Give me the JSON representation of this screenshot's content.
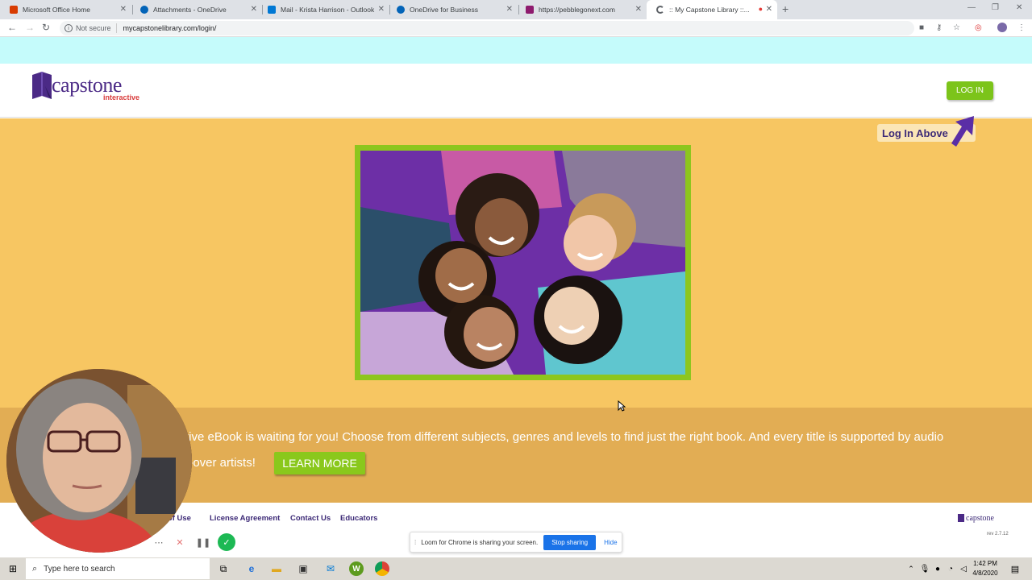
{
  "tabs": [
    {
      "title": "Microsoft Office Home",
      "color": "#d83b01"
    },
    {
      "title": "Attachments - OneDrive",
      "color": "#0364b8"
    },
    {
      "title": "Mail - Krista Harrison - Outlook",
      "color": "#0078d4"
    },
    {
      "title": "OneDrive for Business",
      "color": "#0364b8"
    },
    {
      "title": "https://pebblegonext.com",
      "color": "#8e1b6e"
    },
    {
      "title": ":: My Capstone Library ::...",
      "color": "#5f6368"
    }
  ],
  "address": {
    "security": "Not secure",
    "url": "mycapstonelibrary.com/login/"
  },
  "header": {
    "logo_word": "capstone",
    "logo_sub": "interactive",
    "login_label": "LOG IN"
  },
  "hint": {
    "label": "Log In Above"
  },
  "strip": {
    "line1": "tive eBook is waiting for you! Choose from different subjects, genres and levels to find just the right book. And every title is supported by audio",
    "line2": "e-over artists!",
    "learn_more": "LEARN MORE"
  },
  "footer": {
    "links": [
      "s of Use",
      "License Agreement",
      "Contact Us",
      "Educators"
    ],
    "logo": "capstone",
    "rev": "rev 2.7.12"
  },
  "loom": {
    "message": "Loom for Chrome is sharing your screen.",
    "stop": "Stop sharing",
    "hide": "Hide"
  },
  "taskbar": {
    "search_placeholder": "Type here to search",
    "time": "1:42 PM",
    "date": "4/8/2020"
  },
  "colors": {
    "hero": "#f7c662",
    "strip": "#e2ad54",
    "accent_green": "#7cc41a",
    "brand_purple": "#3d2a77"
  }
}
